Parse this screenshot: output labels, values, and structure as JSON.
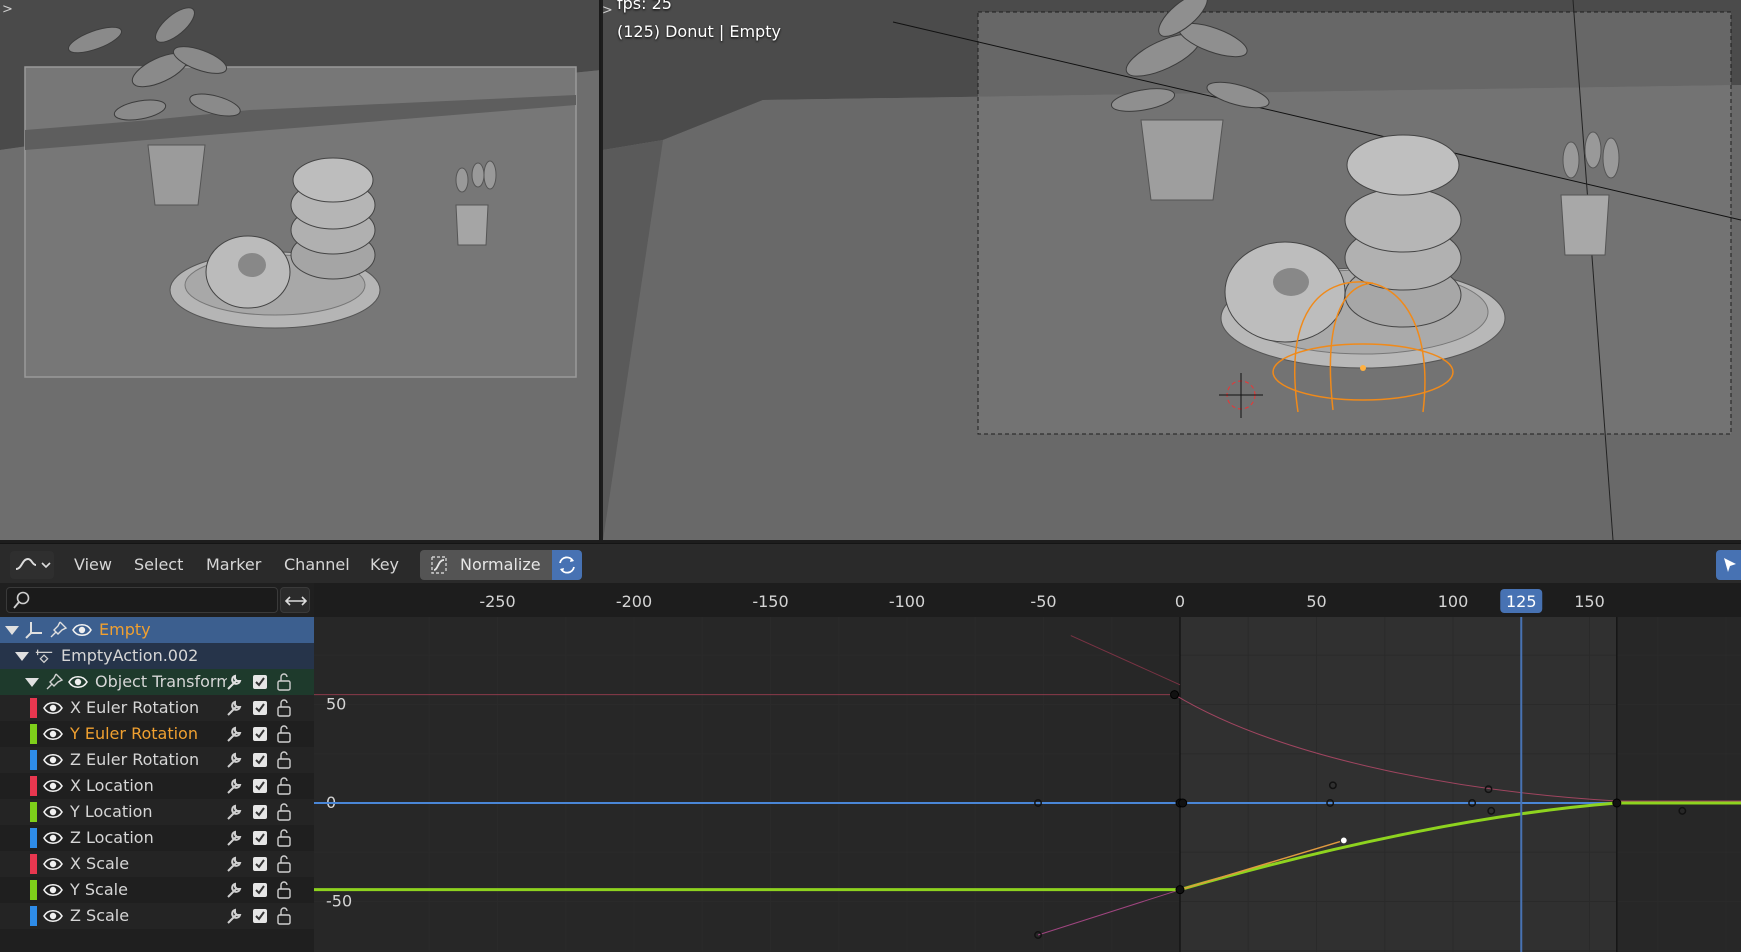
{
  "viewport_left": {
    "corner_arrow": ">"
  },
  "viewport_right": {
    "fps_text": "fps: 25",
    "object_text": "(125) Donut | Empty",
    "corner_arrow": "<>"
  },
  "header": {
    "editor_type_icon": "graph-editor-icon",
    "menus": [
      "View",
      "Select",
      "Marker",
      "Channel",
      "Key"
    ],
    "normalize_label": "Normalize",
    "auto_normalize_icon": "refresh-icon",
    "select_tool_icon": "cursor-arrow-icon"
  },
  "channels": {
    "search_placeholder": "",
    "filter_icon": "swap-arrows-icon",
    "object": {
      "name": "Empty",
      "color": "#f0a030"
    },
    "action": {
      "name": "EmptyAction.002"
    },
    "group": {
      "name": "Object Transforms"
    },
    "fcurves": [
      {
        "name": "X Euler Rotation",
        "color": "#e8374f",
        "selected": false
      },
      {
        "name": "Y Euler Rotation",
        "color": "#7ecf1a",
        "selected": true
      },
      {
        "name": "Z Euler Rotation",
        "color": "#2e8ce8",
        "selected": false
      },
      {
        "name": "X Location",
        "color": "#e8374f",
        "selected": false
      },
      {
        "name": "Y Location",
        "color": "#7ecf1a",
        "selected": false
      },
      {
        "name": "Z Location",
        "color": "#2e8ce8",
        "selected": false
      },
      {
        "name": "X Scale",
        "color": "#e8374f",
        "selected": false
      },
      {
        "name": "Y Scale",
        "color": "#7ecf1a",
        "selected": false
      },
      {
        "name": "Z Scale",
        "color": "#2e8ce8",
        "selected": false
      }
    ]
  },
  "graph": {
    "current_frame": 125,
    "x_ticks": [
      "-250",
      "-200",
      "-150",
      "-100",
      "-50",
      "0",
      "50",
      "100",
      "125",
      "150"
    ],
    "y_ticks": [
      "50",
      "0",
      "-50"
    ],
    "accent": "#4772b3"
  }
}
